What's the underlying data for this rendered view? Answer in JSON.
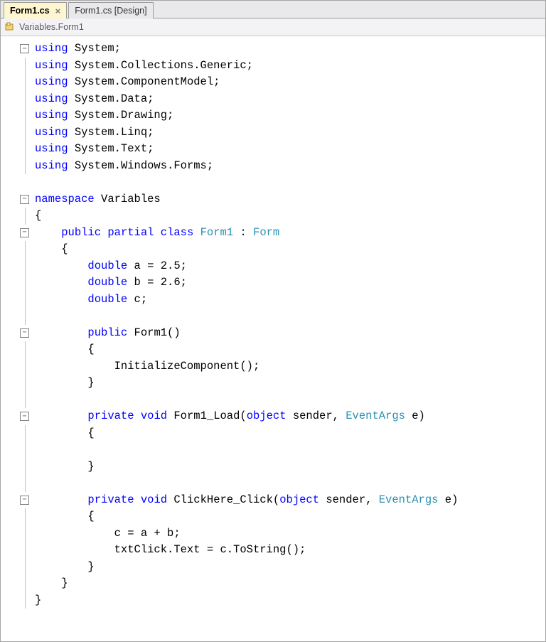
{
  "tabs": [
    {
      "label": "Form1.cs",
      "active": true,
      "closeable": true
    },
    {
      "label": "Form1.cs [Design]",
      "active": false,
      "closeable": false
    }
  ],
  "breadcrumb": "Variables.Form1",
  "code": {
    "usings": [
      "System",
      "System.Collections.Generic",
      "System.ComponentModel",
      "System.Data",
      "System.Drawing",
      "System.Linq",
      "System.Text",
      "System.Windows.Forms"
    ],
    "namespace": "Variables",
    "class_name": "Form1",
    "base_class": "Form",
    "fields": [
      {
        "type": "double",
        "name": "a",
        "init": "2.5"
      },
      {
        "type": "double",
        "name": "b",
        "init": "2.6"
      },
      {
        "type": "double",
        "name": "c",
        "init": null
      }
    ],
    "ctor": {
      "name": "Form1",
      "body": [
        "InitializeComponent();"
      ]
    },
    "methods": [
      {
        "mods": "private",
        "ret": "void",
        "name": "Form1_Load",
        "params": [
          {
            "t": "object",
            "n": "sender"
          },
          {
            "t": "EventArgs",
            "n": "e"
          }
        ],
        "body": [
          ""
        ]
      },
      {
        "mods": "private",
        "ret": "void",
        "name": "ClickHere_Click",
        "params": [
          {
            "t": "object",
            "n": "sender"
          },
          {
            "t": "EventArgs",
            "n": "e"
          }
        ],
        "body": [
          "c = a + b;",
          "txtClick.Text = c.ToString();"
        ]
      }
    ]
  },
  "keywords": [
    "using",
    "namespace",
    "public",
    "partial",
    "class",
    "double",
    "void",
    "private",
    "object"
  ],
  "types": [
    "Form",
    "EventArgs",
    "Form1"
  ]
}
